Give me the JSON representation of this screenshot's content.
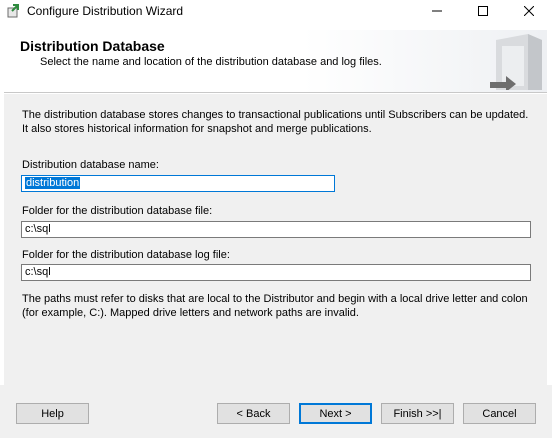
{
  "window": {
    "title": "Configure Distribution Wizard",
    "controls": [
      "minimize-icon",
      "maximize-icon",
      "close-icon"
    ]
  },
  "header": {
    "title": "Distribution Database",
    "subtitle": "Select the name and location of the distribution database and log files."
  },
  "body": {
    "description": "The distribution database stores changes to transactional publications until Subscribers can be updated. It also stores historical information for snapshot and merge publications.",
    "db_name_label": "Distribution database name:",
    "db_name_value": "distribution",
    "db_folder_label": "Folder for the distribution database file:",
    "db_folder_value": "c:\\sql",
    "log_folder_label": "Folder for the distribution database log file:",
    "log_folder_value": "c:\\sql",
    "note": "The paths must refer to disks that are local to the Distributor and begin with a local drive letter and colon (for example, C:). Mapped drive letters and network paths are invalid."
  },
  "footer": {
    "help": "Help",
    "back": "< Back",
    "next": "Next >",
    "finish": "Finish >>|",
    "cancel": "Cancel"
  },
  "colors": {
    "accent": "#0078d7",
    "body_bg": "#f0f0f0",
    "button_bg": "#e1e1e1"
  }
}
